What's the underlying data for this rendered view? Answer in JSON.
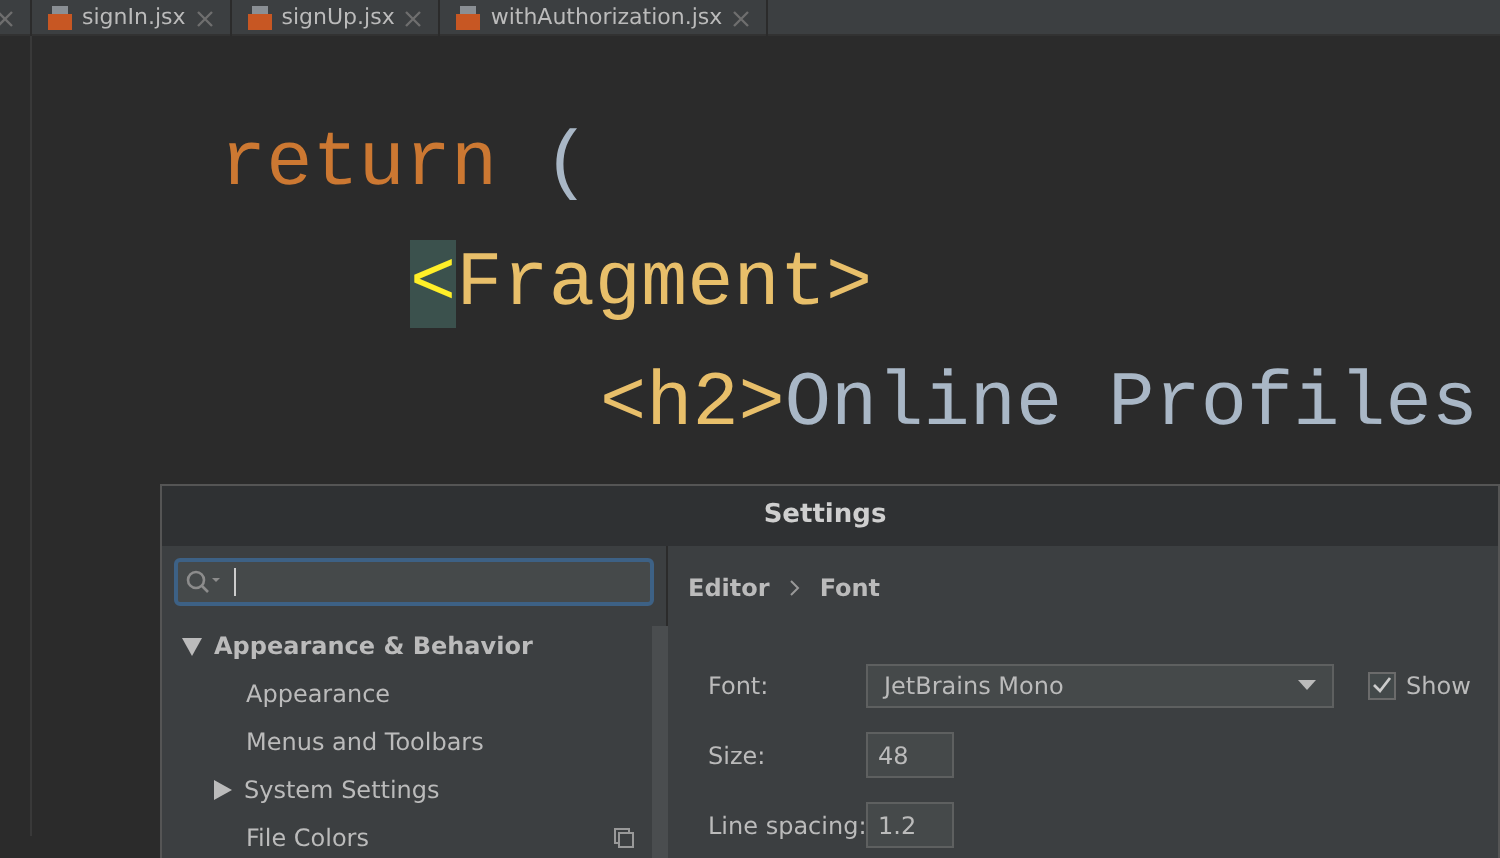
{
  "editor_tabs": [
    {
      "closable": true,
      "selected": false
    },
    {
      "label": "signIn.jsx",
      "closable": true,
      "selected": false
    },
    {
      "label": "signUp.jsx",
      "closable": true,
      "selected": false
    },
    {
      "label": "withAuthorization.jsx",
      "closable": true,
      "selected": false
    }
  ],
  "code_lines": [
    {
      "tokens": [
        {
          "kind": "keyword",
          "text": "return"
        },
        {
          "kind": "punct",
          "text": " ("
        }
      ],
      "children": [
        {
          "tokens": [
            {
              "kind": "matched",
              "text": "<"
            },
            {
              "kind": "tag",
              "text": "Fragment>"
            }
          ],
          "children": [
            {
              "tokens": [
                {
                  "kind": "tag",
                  "text": "<h2>"
                },
                {
                  "kind": "punct",
                  "text": "Online Profiles"
                }
              ]
            }
          ]
        }
      ]
    }
  ],
  "dialog": {
    "title": "Settings",
    "tree": [
      {
        "label": "Appearance & Behavior",
        "expanded": true,
        "children": [
          {
            "label": "Appearance",
            "badge": false
          },
          {
            "label": "Menus and Toolbars",
            "badge": false
          },
          {
            "label": "System Settings",
            "expanded": false,
            "badge": false
          },
          {
            "label": "File Colors",
            "badge": true
          }
        ]
      }
    ],
    "breadcrumb": [
      "Editor",
      "Font"
    ],
    "form": [
      {
        "kind": "dropdown",
        "label": "Font:",
        "value": "JetBrains Mono",
        "checkbox": {
          "label": "Show",
          "checked": true
        }
      },
      {
        "kind": "field",
        "label": "Size:",
        "value": "48"
      },
      {
        "kind": "field",
        "label": "Line spacing:",
        "value": "1.2"
      }
    ]
  }
}
